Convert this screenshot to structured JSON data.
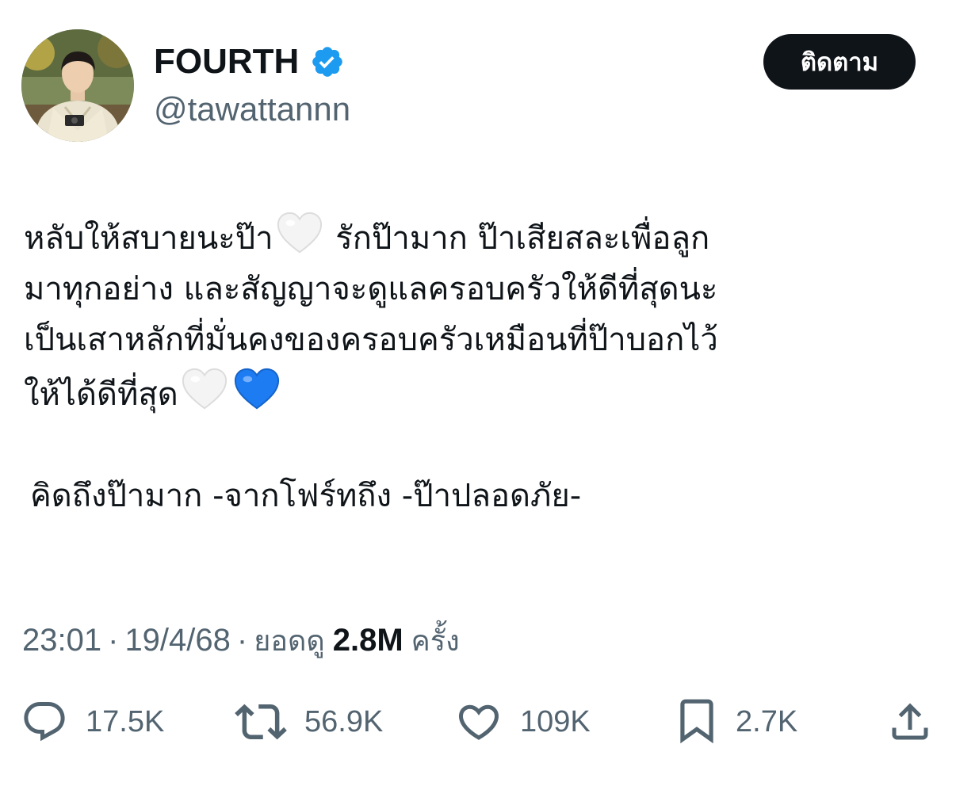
{
  "user": {
    "display_name": "FOURTH",
    "handle": "@tawattannn",
    "verified": true,
    "verified_color": "#1d9bf0"
  },
  "follow_button": {
    "label": "ติดตาม"
  },
  "tweet": {
    "line1_a": "หลับให้สบายนะป๊า",
    "line1_b": " รักป๊ามาก ป๊าเสียสละเพื่อลูก",
    "line2": "มาทุกอย่าง และสัญญาจะดูแลครอบครัวให้ดีที่สุดนะ",
    "line3": "เป็นเสาหลักที่มั่นคงของครอบครัวเหมือนที่ป๊าบอกไว้",
    "line4": "ให้ได้ดีที่สุด",
    "signature": "คิดถึงป๊ามาก  -จากโฟร์ทถึง -ป๊าปลอดภัย-",
    "emoji": [
      "white-heart",
      "white-heart",
      "blue-heart"
    ]
  },
  "meta": {
    "time": "23:01",
    "date": "19/4/68",
    "views_label": "ยอดดู",
    "views_count": "2.8M",
    "views_suffix": "ครั้ง",
    "separator": "·"
  },
  "actions": {
    "replies": "17.5K",
    "retweets": "56.9K",
    "likes": "109K",
    "bookmarks": "2.7K"
  },
  "icons": {
    "reply": "reply-icon",
    "retweet": "retweet-icon",
    "like": "heart-icon",
    "bookmark": "bookmark-icon",
    "share": "share-icon"
  },
  "colors": {
    "text_primary": "#0f1419",
    "text_secondary": "#536471",
    "follow_bg": "#0f1419",
    "blue_heart": "#1d7cf2"
  }
}
